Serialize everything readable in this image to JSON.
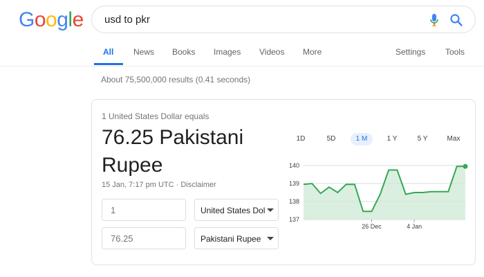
{
  "logo": {
    "text": "Google",
    "letters": [
      "G",
      "o",
      "o",
      "g",
      "l",
      "e"
    ],
    "colors": [
      "#4285f4",
      "#ea4335",
      "#fbbc05",
      "#4285f4",
      "#34a853",
      "#ea4335"
    ]
  },
  "search": {
    "query": "usd to pkr",
    "icons": [
      "microphone-icon",
      "search-icon"
    ]
  },
  "nav": {
    "tabs": [
      {
        "label": "All",
        "active": true
      },
      {
        "label": "News"
      },
      {
        "label": "Books"
      },
      {
        "label": "Images"
      },
      {
        "label": "Videos"
      },
      {
        "label": "More"
      }
    ],
    "settings": "Settings",
    "tools": "Tools"
  },
  "stats": "About 75,500,000 results (0.41 seconds)",
  "converter": {
    "label": "1 United States Dollar equals",
    "result": "76.25 Pakistani Rupee",
    "timestamp": "15 Jan, 7:17 pm UTC · Disclaimer",
    "from_amount": "1",
    "to_amount": "76.25",
    "from_currency": "United States Dollar",
    "to_currency": "Pakistani Rupee",
    "ranges": [
      "1D",
      "5D",
      "1 M",
      "1 Y",
      "5 Y",
      "Max"
    ],
    "selected_range": "1 M"
  },
  "colors": {
    "accent": "#1a73e8",
    "line": "#34a853",
    "fill": "#ceead6"
  },
  "chart_data": {
    "type": "area",
    "x": [
      0,
      1,
      2,
      3,
      4,
      5,
      6,
      7,
      8,
      9,
      10,
      11,
      12,
      13,
      14,
      15,
      16,
      17,
      18,
      19
    ],
    "values": [
      138.95,
      139.0,
      138.45,
      138.8,
      138.5,
      138.95,
      138.95,
      137.45,
      137.45,
      138.4,
      139.75,
      139.75,
      138.4,
      138.5,
      138.5,
      138.55,
      138.55,
      138.55,
      139.95,
      139.95
    ],
    "yticks": [
      137,
      138,
      139,
      140
    ],
    "ytick_labels": [
      "137",
      "138",
      "139",
      "140"
    ],
    "ylim": [
      137,
      140
    ],
    "xtick_labels": [
      "26 Dec",
      "4 Jan"
    ],
    "xtick_index": [
      8,
      13
    ],
    "grid": true
  }
}
